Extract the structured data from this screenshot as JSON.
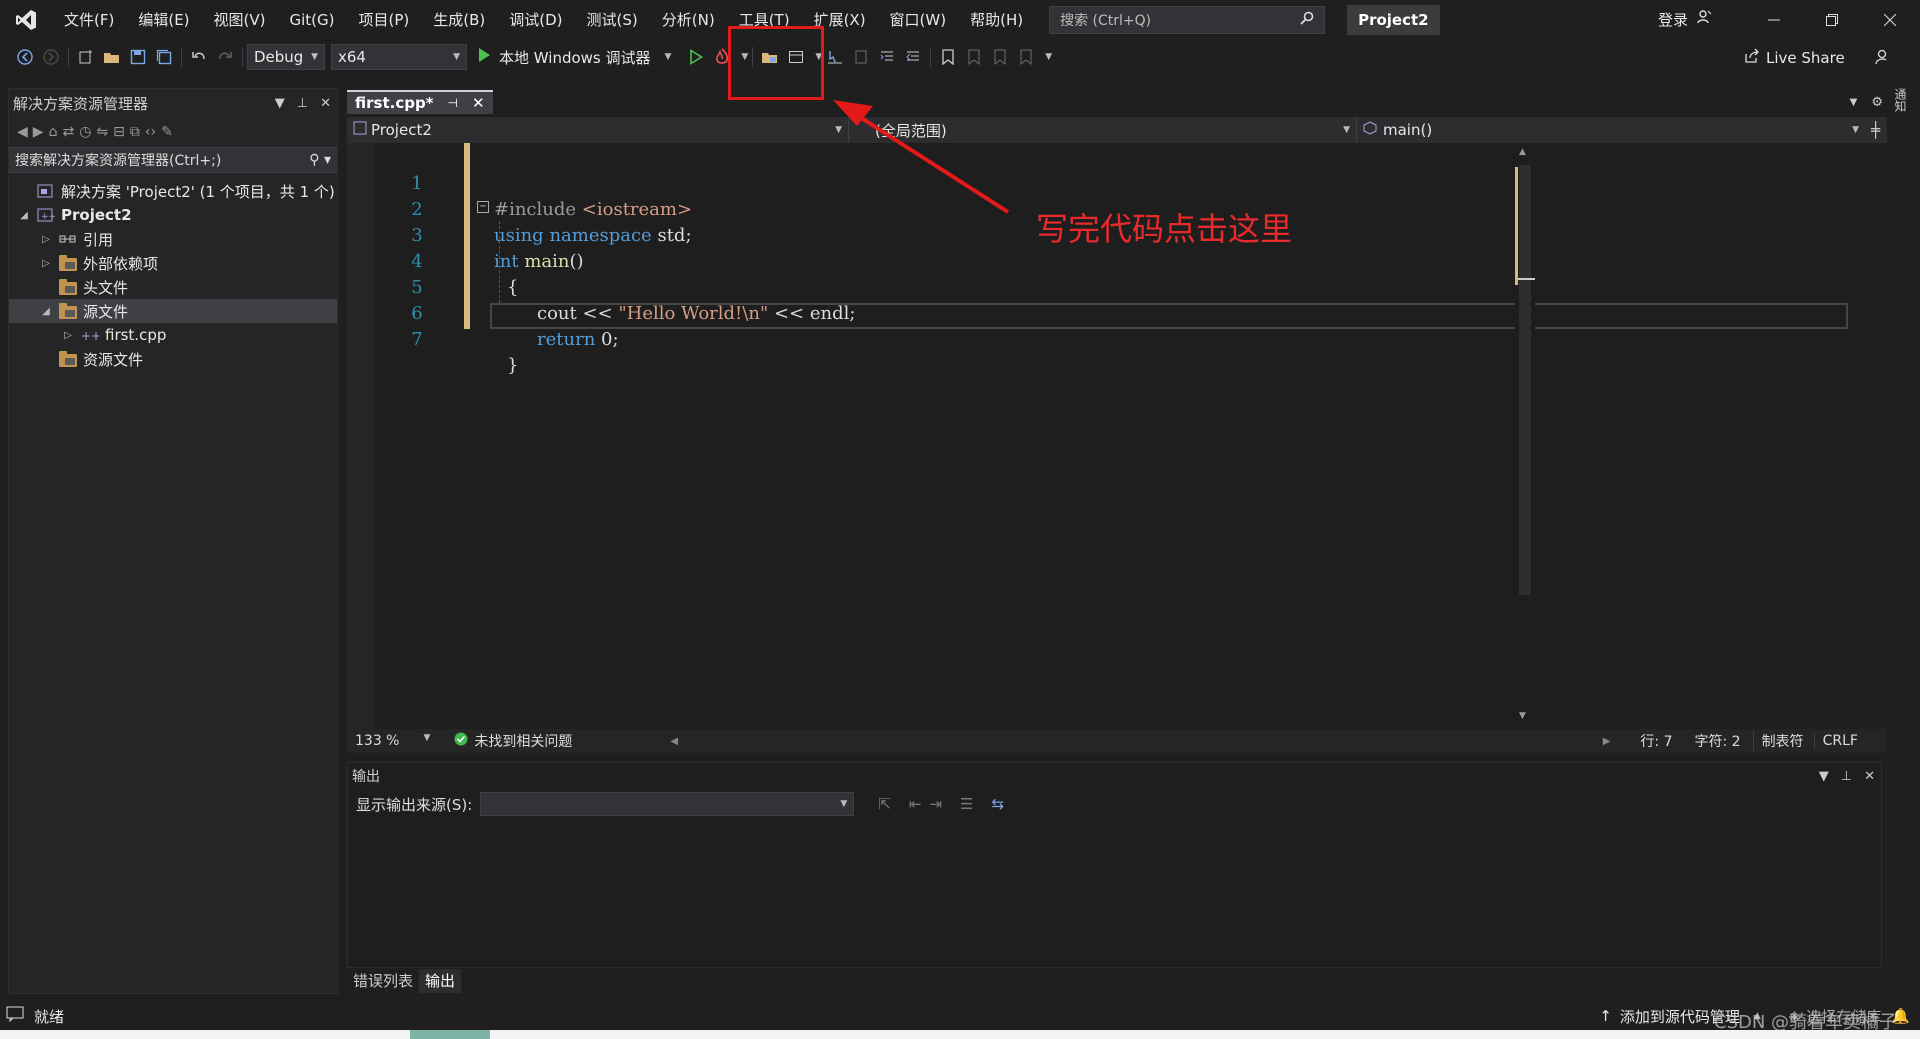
{
  "menu": {
    "items": [
      "文件(F)",
      "编辑(E)",
      "视图(V)",
      "Git(G)",
      "项目(P)",
      "生成(B)",
      "调试(D)",
      "测试(S)",
      "分析(N)",
      "工具(T)",
      "扩展(X)",
      "窗口(W)",
      "帮助(H)"
    ]
  },
  "search": {
    "placeholder": "搜索 (Ctrl+Q)"
  },
  "project_badge": "Project2",
  "login": "登录",
  "toolbar": {
    "config": "Debug",
    "platform": "x64",
    "run_label": "本地 Windows 调试器",
    "live_share": "Live Share"
  },
  "solution_explorer": {
    "title": "解决方案资源管理器",
    "search_placeholder": "搜索解决方案资源管理器(Ctrl+;)",
    "tree": {
      "solution": "解决方案 'Project2' (1 个项目，共 1 个)",
      "project": "Project2",
      "references": "引用",
      "external": "外部依赖项",
      "headers": "头文件",
      "sources": "源文件",
      "file": "first.cpp",
      "resources": "资源文件"
    }
  },
  "editor": {
    "tab_label": "first.cpp*",
    "nav_project": "Project2",
    "nav_scope": "(全局范围)",
    "nav_member": "main()",
    "line_numbers": [
      "1",
      "2",
      "3",
      "4",
      "5",
      "6",
      "7"
    ],
    "code": {
      "l1_directive": "#include",
      "l1_header": "<iostream>",
      "l2_using": "using",
      "l2_namespace": "namespace",
      "l2_rest": "std;",
      "l3_int": "int",
      "l3_main": "main",
      "l3_parens": "()",
      "l4": "{",
      "l5_cout": "cout << ",
      "l5_string": "\"Hello World!\\n\"",
      "l5_rest": " << endl;",
      "l6_return": "return",
      "l6_rest": " 0;",
      "l7": "}"
    },
    "zoom": "133 %",
    "issues": "未找到相关问题",
    "line": "行: 7",
    "char": "字符: 2",
    "tabs": "制表符",
    "eol": "CRLF"
  },
  "output": {
    "title": "输出",
    "source_label": "显示输出来源(S):"
  },
  "bottom_tabs": [
    "错误列表",
    "输出"
  ],
  "annotation": {
    "text": "写完代码点击这里",
    "color": "#e31a1a"
  },
  "statusbar": {
    "ready": "就绪",
    "source_control": "添加到源代码管理",
    "repo": "选择存储库",
    "watermark": "CSDN @骑着车卖橘子"
  }
}
